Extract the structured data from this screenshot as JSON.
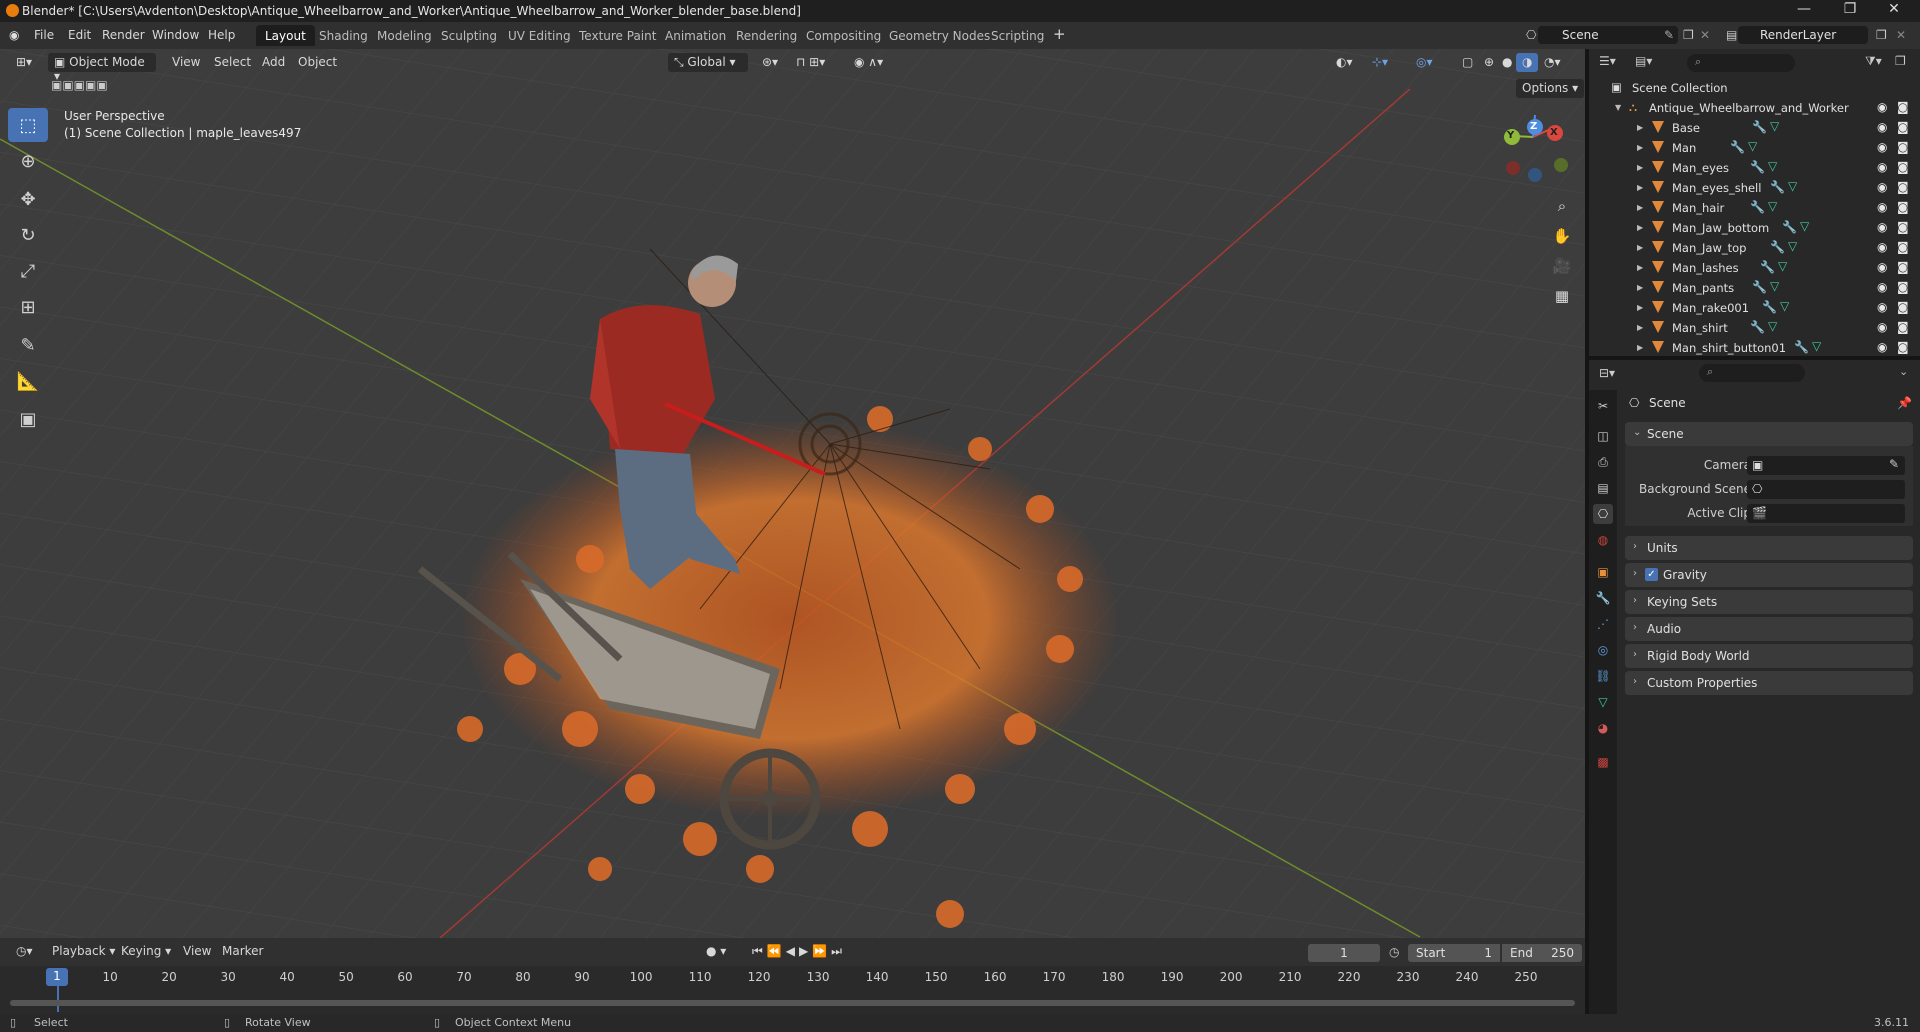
{
  "window": {
    "title": "Blender* [C:\\Users\\Avdenton\\Desktop\\Antique_Wheelbarrow_and_Worker\\Antique_Wheelbarrow_and_Worker_blender_base.blend]"
  },
  "menu": [
    "File",
    "Edit",
    "Render",
    "Window",
    "Help"
  ],
  "workspaces": [
    "Layout",
    "Shading",
    "Modeling",
    "Sculpting",
    "UV Editing",
    "Texture Paint",
    "Animation",
    "Rendering",
    "Compositing",
    "Geometry Nodes",
    "Scripting"
  ],
  "active_workspace": "Layout",
  "scene_name": "Scene",
  "view_layer": "RenderLayer",
  "viewport": {
    "mode": "Object Mode",
    "menus": [
      "View",
      "Select",
      "Add",
      "Object"
    ],
    "orientation": "Global",
    "options_label": "Options",
    "overlay_line1": "User Perspective",
    "overlay_line2": "(1) Scene Collection | maple_leaves497",
    "gizmo_axes": [
      "X",
      "Y",
      "Z"
    ]
  },
  "outliner": {
    "root": "Scene Collection",
    "collection": "Antique_Wheelbarrow_and_Worker",
    "objects": [
      "Base",
      "Man",
      "Man_eyes",
      "Man_eyes_shell",
      "Man_hair",
      "Man_Jaw_bottom",
      "Man_Jaw_top",
      "Man_lashes",
      "Man_pants",
      "Man_rake001",
      "Man_shirt",
      "Man_shirt_button01"
    ]
  },
  "properties": {
    "context": "Scene",
    "panel_open": "Scene",
    "fields": [
      {
        "label": "Camera"
      },
      {
        "label": "Background Scene"
      },
      {
        "label": "Active Clip"
      }
    ],
    "panels": [
      "Units",
      "Gravity",
      "Keying Sets",
      "Audio",
      "Rigid Body World",
      "Custom Properties"
    ],
    "gravity_checked": true
  },
  "timeline": {
    "menus": [
      "Playback",
      "Keying",
      "View",
      "Marker"
    ],
    "current_frame": "1",
    "start_label": "Start",
    "start": "1",
    "end_label": "End",
    "end": "250",
    "ticks": [
      "1",
      "10",
      "20",
      "30",
      "40",
      "50",
      "60",
      "70",
      "80",
      "90",
      "100",
      "110",
      "120",
      "130",
      "140",
      "150",
      "160",
      "170",
      "180",
      "190",
      "200",
      "210",
      "220",
      "230",
      "240",
      "250"
    ]
  },
  "status": {
    "select": "Select",
    "rotate": "Rotate View",
    "context_menu": "Object Context Menu",
    "version": "3.6.11"
  },
  "colors": {
    "accent": "#4772b3",
    "x_axis": "#d9473d",
    "y_axis": "#8fba3a",
    "z_axis": "#4f8de0",
    "mesh_icon": "#e0883b"
  }
}
